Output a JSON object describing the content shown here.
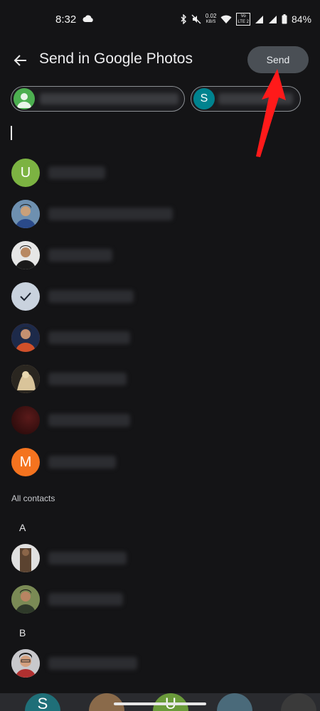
{
  "status": {
    "time": "8:32",
    "net_speed": "0.02",
    "net_unit": "KB/S",
    "vo": "Vo",
    "lte": "LTE 2",
    "battery": "84%"
  },
  "header": {
    "title": "Send in Google Photos",
    "send_label": "Send"
  },
  "chips": [
    {
      "avatar_type": "person-icon",
      "color": "#4caf50"
    },
    {
      "avatar_letter": "S",
      "color": "#00838f"
    }
  ],
  "contacts": [
    {
      "avatar_type": "letter",
      "letter": "U",
      "color": "#7cb342"
    },
    {
      "avatar_type": "photo",
      "color": "#5a7fa8"
    },
    {
      "avatar_type": "photo",
      "color": "#2f3b2a"
    },
    {
      "avatar_type": "selected-check",
      "color": "#c9d2de"
    },
    {
      "avatar_type": "photo",
      "color": "#c0522f"
    },
    {
      "avatar_type": "photo",
      "color": "#b39a72"
    },
    {
      "avatar_type": "photo",
      "color": "#3a1414"
    },
    {
      "avatar_type": "letter",
      "letter": "M",
      "color": "#f4731f"
    }
  ],
  "all_contacts": {
    "label": "All contacts",
    "groups": [
      {
        "letter": "A",
        "contacts": [
          {
            "avatar_type": "photo",
            "color": "#5b4a3d"
          },
          {
            "avatar_type": "photo",
            "color": "#4a5a3a"
          }
        ]
      },
      {
        "letter": "B",
        "contacts": [
          {
            "avatar_type": "photo",
            "color": "#b8b8c0"
          }
        ]
      }
    ]
  },
  "bottom_strip": {
    "letter": "S",
    "letter2": "U"
  }
}
